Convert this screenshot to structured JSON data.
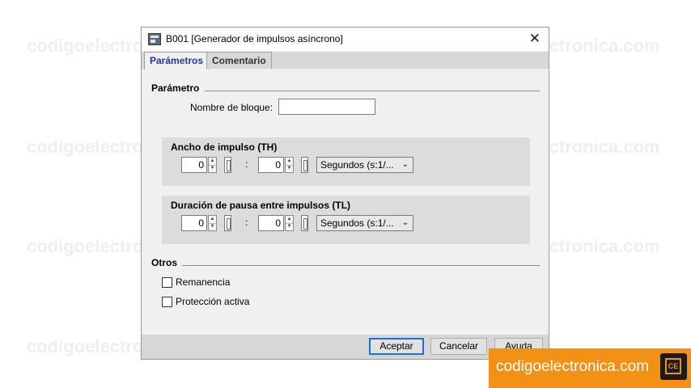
{
  "watermark": "codigoelectronica.com",
  "dialog": {
    "title": "B001 [Generador de impulsos asíncrono]",
    "close_symbol": "✕",
    "icon": "app-icon"
  },
  "tabs": [
    {
      "label": "Parámetros",
      "active": true
    },
    {
      "label": "Comentario",
      "active": false
    }
  ],
  "parametro": {
    "section_label": "Parámetro",
    "block_name_label": "Nombre de bloque:",
    "block_name_value": ""
  },
  "pulse_width": {
    "title": "Ancho de impulso (TH)",
    "value1": "0",
    "separator": ":",
    "value2": "0",
    "unit": "Segundos (s:1/..."
  },
  "pause_duration": {
    "title": "Duración de pausa entre impulsos (TL)",
    "value1": "0",
    "separator": ":",
    "value2": "0",
    "unit": "Segundos (s:1/..."
  },
  "otros": {
    "section_label": "Otros",
    "remanencia_label": "Remanencia",
    "remanencia_checked": false,
    "proteccion_label": "Protección activa",
    "proteccion_checked": false
  },
  "buttons": {
    "accept": "Aceptar",
    "cancel": "Cancelar",
    "help": "Ayuda"
  },
  "logo": {
    "text": "codigoelectronica.com",
    "chip_text": "CE"
  },
  "colors": {
    "accent_orange": "#f29116",
    "tab_active_text": "#1f3a99",
    "default_button_border": "#1f6fd1"
  }
}
